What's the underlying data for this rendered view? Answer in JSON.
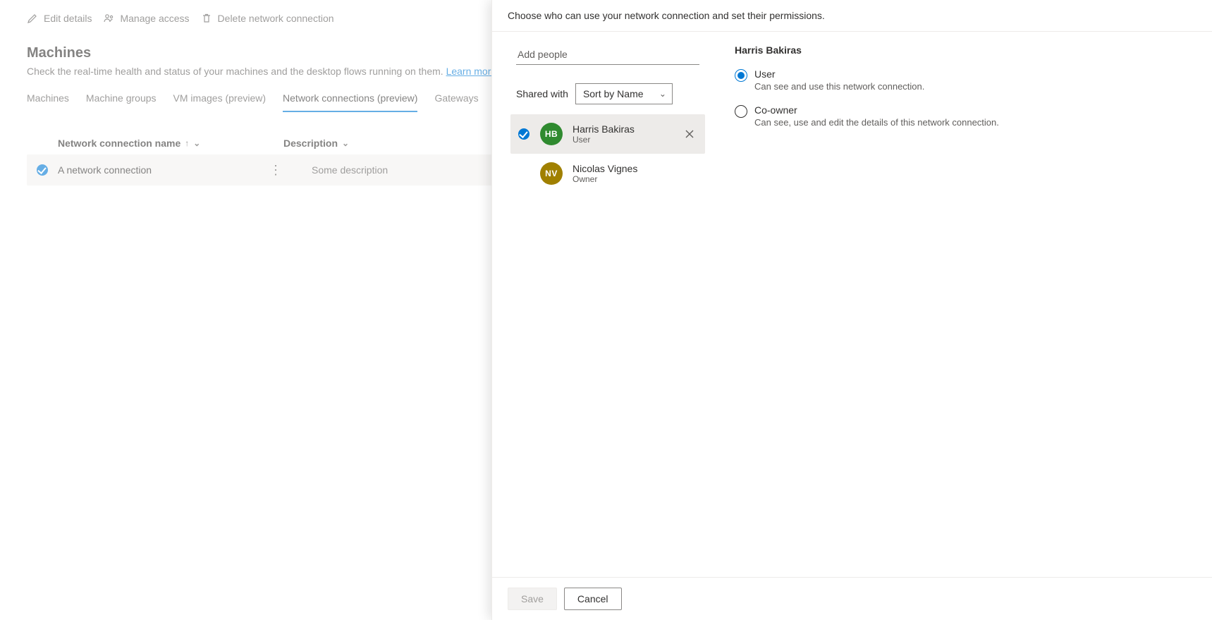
{
  "cmd": {
    "edit": "Edit details",
    "manage": "Manage access",
    "delete": "Delete network connection"
  },
  "page": {
    "title": "Machines",
    "subtitle": "Check the real-time health and status of your machines and the desktop flows running on them. ",
    "learn_more": "Learn more"
  },
  "tabs": {
    "machines": "Machines",
    "groups": "Machine groups",
    "vm": "VM images (preview)",
    "net": "Network connections (preview)",
    "gateways": "Gateways"
  },
  "table": {
    "col_name": "Network connection name",
    "col_desc": "Description",
    "rows": [
      {
        "name": "A network connection",
        "desc": "Some description"
      }
    ]
  },
  "panel": {
    "header": "Choose who can use your network connection and set their permissions.",
    "add_people_placeholder": "Add people",
    "shared_with_label": "Shared with",
    "sort_label": "Sort by Name",
    "people": [
      {
        "initials": "HB",
        "name": "Harris Bakiras",
        "role": "User",
        "avatarClass": "hb",
        "selected": true,
        "removable": true
      },
      {
        "initials": "NV",
        "name": "Nicolas Vignes",
        "role": "Owner",
        "avatarClass": "nv",
        "selected": false,
        "removable": false
      }
    ],
    "right": {
      "title": "Harris Bakiras",
      "options": [
        {
          "label": "User",
          "desc": "Can see and use this network connection.",
          "checked": true
        },
        {
          "label": "Co-owner",
          "desc": "Can see, use and edit the details of this network connection.",
          "checked": false
        }
      ]
    },
    "footer": {
      "save": "Save",
      "cancel": "Cancel"
    }
  }
}
